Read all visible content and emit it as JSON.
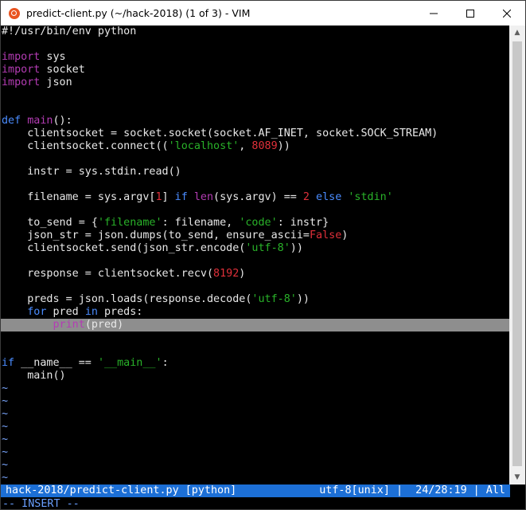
{
  "window": {
    "title": "predict-client.py (~/hack-2018) (1 of 3) - VIM",
    "icon": "vim-app-icon"
  },
  "editor": {
    "lines": [
      [
        {
          "t": "#!/usr/bin/env python",
          "c": ""
        }
      ],
      [],
      [
        {
          "t": "import",
          "c": "imp"
        },
        {
          "t": " sys",
          "c": ""
        }
      ],
      [
        {
          "t": "import",
          "c": "imp"
        },
        {
          "t": " socket",
          "c": ""
        }
      ],
      [
        {
          "t": "import",
          "c": "imp"
        },
        {
          "t": " json",
          "c": ""
        }
      ],
      [],
      [],
      [
        {
          "t": "def",
          "c": "kw"
        },
        {
          "t": " ",
          "c": ""
        },
        {
          "t": "main",
          "c": "fn"
        },
        {
          "t": "():",
          "c": ""
        }
      ],
      [
        {
          "t": "    clientsocket = socket.socket(socket.AF_INET, socket.SOCK_STREAM)",
          "c": ""
        }
      ],
      [
        {
          "t": "    clientsocket.connect((",
          "c": ""
        },
        {
          "t": "'localhost'",
          "c": "str"
        },
        {
          "t": ", ",
          "c": ""
        },
        {
          "t": "8089",
          "c": "num"
        },
        {
          "t": "))",
          "c": ""
        }
      ],
      [],
      [
        {
          "t": "    instr = sys.stdin.read()",
          "c": ""
        }
      ],
      [],
      [
        {
          "t": "    filename = sys.argv[",
          "c": ""
        },
        {
          "t": "1",
          "c": "num"
        },
        {
          "t": "] ",
          "c": ""
        },
        {
          "t": "if",
          "c": "kw"
        },
        {
          "t": " ",
          "c": ""
        },
        {
          "t": "len",
          "c": "fn"
        },
        {
          "t": "(sys.argv) == ",
          "c": ""
        },
        {
          "t": "2",
          "c": "num"
        },
        {
          "t": " ",
          "c": ""
        },
        {
          "t": "else",
          "c": "kw"
        },
        {
          "t": " ",
          "c": ""
        },
        {
          "t": "'stdin'",
          "c": "str"
        }
      ],
      [],
      [
        {
          "t": "    to_send = {",
          "c": ""
        },
        {
          "t": "'filename'",
          "c": "str"
        },
        {
          "t": ": filename, ",
          "c": ""
        },
        {
          "t": "'code'",
          "c": "str"
        },
        {
          "t": ": instr}",
          "c": ""
        }
      ],
      [
        {
          "t": "    json_str = json.dumps(to_send, ensure_ascii=",
          "c": ""
        },
        {
          "t": "False",
          "c": "bool"
        },
        {
          "t": ")",
          "c": ""
        }
      ],
      [
        {
          "t": "    clientsocket.send(json_str.encode(",
          "c": ""
        },
        {
          "t": "'utf-8'",
          "c": "str"
        },
        {
          "t": "))",
          "c": ""
        }
      ],
      [],
      [
        {
          "t": "    response = clientsocket.recv(",
          "c": ""
        },
        {
          "t": "8192",
          "c": "num"
        },
        {
          "t": ")",
          "c": ""
        }
      ],
      [],
      [
        {
          "t": "    preds = json.loads(response.decode(",
          "c": ""
        },
        {
          "t": "'utf-8'",
          "c": "str"
        },
        {
          "t": "))",
          "c": ""
        }
      ],
      [
        {
          "t": "    ",
          "c": ""
        },
        {
          "t": "for",
          "c": "kw"
        },
        {
          "t": " pred ",
          "c": ""
        },
        {
          "t": "in",
          "c": "kw"
        },
        {
          "t": " preds:",
          "c": ""
        }
      ],
      [
        {
          "t": "        ",
          "c": ""
        },
        {
          "t": "print",
          "c": "fn"
        },
        {
          "t": "(pred)",
          "c": ""
        }
      ],
      [],
      [],
      [
        {
          "t": "if",
          "c": "kw"
        },
        {
          "t": " __name__ == ",
          "c": ""
        },
        {
          "t": "'__main__'",
          "c": "str"
        },
        {
          "t": ":",
          "c": ""
        }
      ],
      [
        {
          "t": "    main()",
          "c": ""
        }
      ],
      [
        {
          "t": "~",
          "c": "tilde"
        }
      ],
      [
        {
          "t": "~",
          "c": "tilde"
        }
      ],
      [
        {
          "t": "~",
          "c": "tilde"
        }
      ],
      [
        {
          "t": "~",
          "c": "tilde"
        }
      ],
      [
        {
          "t": "~",
          "c": "tilde"
        }
      ],
      [
        {
          "t": "~",
          "c": "tilde"
        }
      ],
      [
        {
          "t": "~",
          "c": "tilde"
        }
      ],
      [
        {
          "t": "~",
          "c": "tilde"
        }
      ]
    ],
    "cursor_line_index": 23
  },
  "statusline": {
    "left": "hack-2018/predict-client.py [python]",
    "right": "utf-8[unix] |  24/28:19 | All"
  },
  "modeline": {
    "text": "-- INSERT --"
  },
  "colors": {
    "statusline_bg": "#1c6fd6",
    "cursorline_bg": "#8e8e8e",
    "keyword": "#4a8cff",
    "string": "#29b229",
    "number": "#e0303a",
    "builtin": "#b43cb4"
  }
}
